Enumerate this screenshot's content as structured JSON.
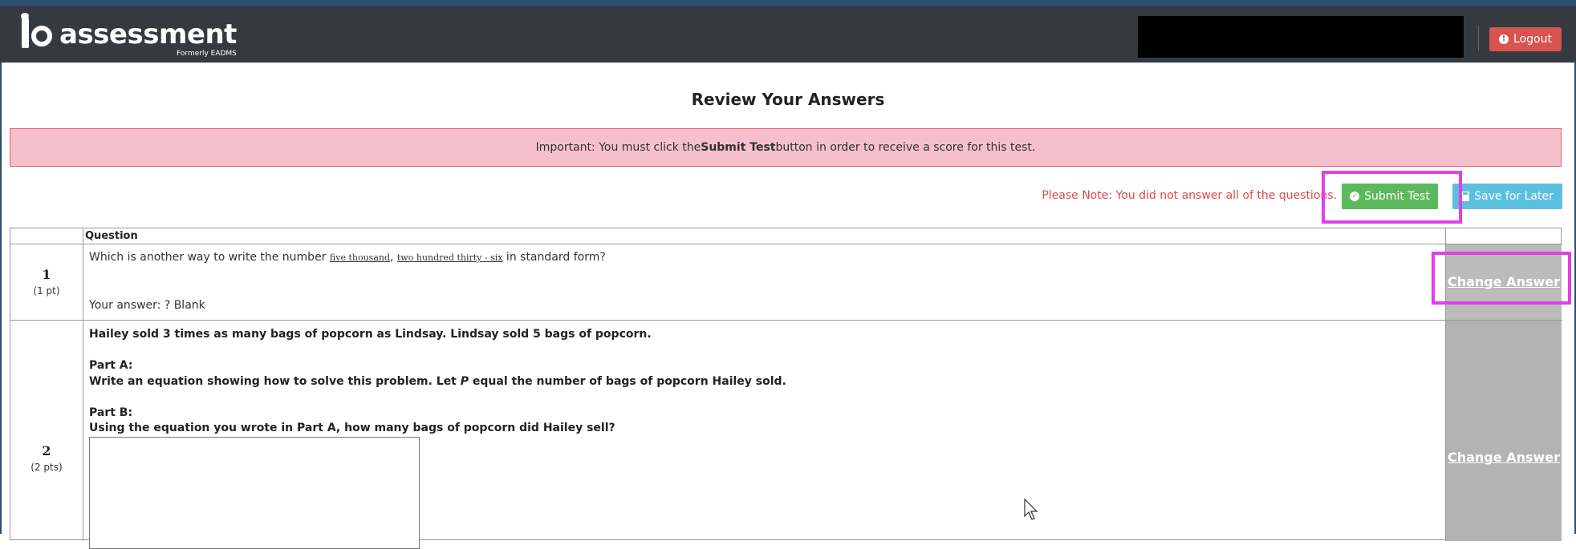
{
  "header": {
    "logo_text": "assessment",
    "logo_subtitle": "Formerly EADMS",
    "logout_label": "Logout"
  },
  "page": {
    "title": "Review Your Answers",
    "alert_prefix": "Important: You must click the ",
    "alert_bold": "Submit Test",
    "alert_suffix": " button in order to receive a score for this test.",
    "note": "Please Note: You did not answer all of the questions.",
    "submit_label": "Submit Test",
    "save_label": "Save for Later"
  },
  "table": {
    "header_question": "Question",
    "rows": [
      {
        "number": "1",
        "points": "(1 pt)",
        "text_prefix": "Which is another way to write the number ",
        "text_u1": "five thousand",
        "text_sep": ", ",
        "text_u2": "two hundred thirty - six",
        "text_suffix": " in standard form?",
        "answer_label": "Your answer: ? Blank",
        "action_label": "Change Answer"
      },
      {
        "number": "2",
        "points": "(2 pts)",
        "line1": "Hailey sold 3 times as many bags of popcorn as Lindsay.  Lindsay sold 5 bags of popcorn.",
        "part_a": "Part A:",
        "part_a_text_prefix": "Write an equation showing how to solve this problem.  Let ",
        "part_a_var": "P",
        "part_a_text_suffix": " equal the number of bags of popcorn Hailey sold.",
        "part_b": "Part B:",
        "part_b_text": "Using the equation you wrote in Part A, how many bags of popcorn did Hailey sell?",
        "action_label": "Change Answer"
      }
    ]
  },
  "colors": {
    "header_bg": "#343a40",
    "logout_bg": "#d9534f",
    "alert_bg": "#f5c0cb",
    "note_color": "#e0464e",
    "submit_bg": "#5cb85c",
    "save_bg": "#5bc0de",
    "highlight": "#e040e8",
    "action_col_bg": "#b3b3b3"
  },
  "icons": {
    "logout": "exclamation-circle-icon",
    "submit": "check-circle-icon",
    "save": "floppy-disk-icon"
  }
}
